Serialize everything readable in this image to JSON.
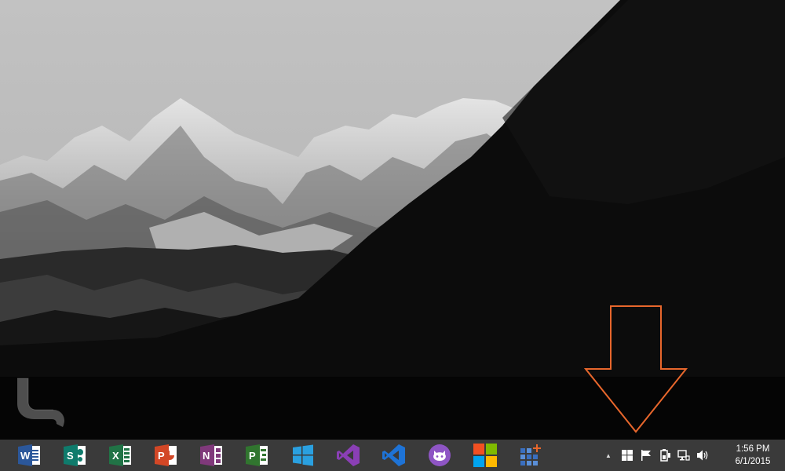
{
  "taskbar": {
    "apps": [
      {
        "name": "word",
        "letter": "W",
        "color": "#2b579a"
      },
      {
        "name": "sharepoint",
        "letter": "S",
        "color": "#0f7b6c"
      },
      {
        "name": "excel",
        "letter": "X",
        "color": "#217346"
      },
      {
        "name": "powerpoint",
        "letter": "P",
        "color": "#d24726"
      },
      {
        "name": "onenote",
        "letter": "N",
        "color": "#80397b"
      },
      {
        "name": "project",
        "letter": "P",
        "color": "#31752f"
      },
      {
        "name": "windows-store",
        "color": "#2aa0e0"
      },
      {
        "name": "visual-studio",
        "color": "#68217a"
      },
      {
        "name": "visual-studio-code",
        "color": "#1e73d6"
      },
      {
        "name": "github",
        "color": "#8e55c4"
      },
      {
        "name": "microsoft",
        "colors": [
          "#f25022",
          "#7fba00",
          "#00a4ef",
          "#ffb900"
        ]
      },
      {
        "name": "tile-app",
        "color": "#3a6fbf"
      }
    ],
    "tray": {
      "overflow_label": "▲",
      "time": "1:56 PM",
      "date": "6/1/2015"
    }
  },
  "annotation": {
    "arrow_color": "#e8672c"
  }
}
